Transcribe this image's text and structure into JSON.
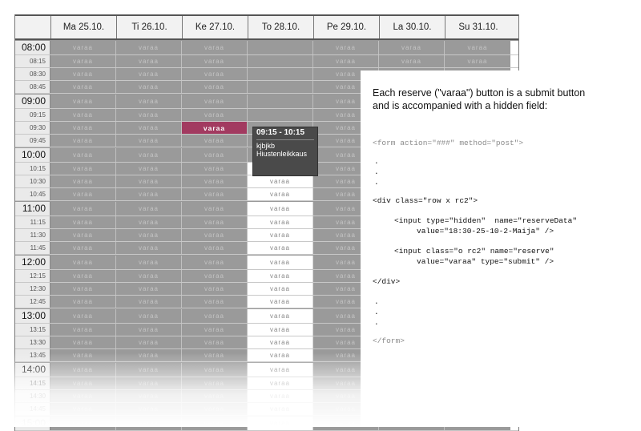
{
  "calendar": {
    "days": [
      "Ma 25.10.",
      "Ti 26.10.",
      "Ke 27.10.",
      "To 28.10.",
      "Pe 29.10.",
      "La 30.10.",
      "Su 31.10."
    ],
    "slot_label": "varaa",
    "times": [
      "08:00",
      "08:15",
      "08:30",
      "08:45",
      "09:00",
      "09:15",
      "09:30",
      "09:45",
      "10:00",
      "10:15",
      "10:30",
      "10:45",
      "11:00",
      "11:15",
      "11:30",
      "11:45",
      "12:00",
      "12:15",
      "12:30",
      "12:45",
      "13:00",
      "13:15",
      "13:30",
      "13:45",
      "14:00",
      "14:15",
      "14:30",
      "14:45",
      "15:00"
    ],
    "booking": {
      "time": "09:15 - 10:15",
      "name": "kjbjkb",
      "service": "Hiustenleikkaus"
    }
  },
  "panel": {
    "description": "Each reserve (\"varaa\") button is a submit button\nand is accompanied with a hidden field:",
    "form_open": "<form action=\"###\" method=\"post\">",
    "dot": ".",
    "div_open": "<div class=\"row x rc2\">",
    "input_hidden_1": "<input type=\"hidden\"  name=\"reserveData\"",
    "input_hidden_2": "value=\"18:30-25-10-2-Maija\" />",
    "input_submit_1": "<input class=\"o rc2\" name=\"reserve\"",
    "input_submit_2": "value=\"varaa\" type=\"submit\" />",
    "div_close": "</div>",
    "form_close": "</form>"
  }
}
